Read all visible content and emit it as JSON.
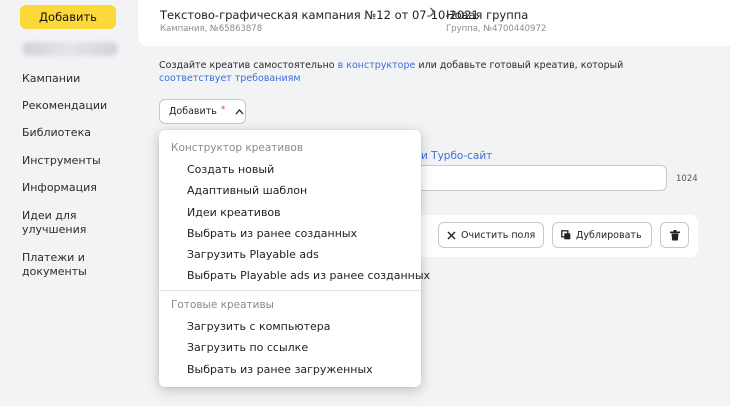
{
  "sidebar": {
    "add_label": "Добавить",
    "items": [
      {
        "label": "Кампании"
      },
      {
        "label": "Рекомендации"
      },
      {
        "label": "Библиотека"
      },
      {
        "label": "Инструменты"
      },
      {
        "label": "Информация"
      },
      {
        "label": "Идеи для улучшения"
      },
      {
        "label": "Платежи и документы"
      }
    ]
  },
  "breadcrumb": {
    "campaign_title": "Текстово-графическая кампания №12 от 07-10-2021",
    "campaign_sub": "Кампания, №65863878",
    "group_title": "Новая группа",
    "group_sub": "Группа, №4700440972"
  },
  "intro": {
    "part1": "Создайте креатив самостоятельно ",
    "link1": "в конструкторе",
    "part2": " или добавьте готовый креатив, который ",
    "link2": "соответствует требованиям"
  },
  "add_dropdown": {
    "label": "Добавить",
    "required_mark": "*"
  },
  "background": {
    "turbo_link": "и Турбо-сайт",
    "counter": "1024",
    "clear_label": "Очистить поля",
    "duplicate_label": "Дублировать"
  },
  "menu": {
    "group1_title": "Конструктор креативов",
    "group1_items": [
      "Создать новый",
      "Адаптивный шаблон",
      "Идеи креативов",
      "Выбрать из ранее созданных",
      "Загрузить Playable ads",
      "Выбрать Playable ads из ранее созданных"
    ],
    "group2_title": "Готовые креативы",
    "group2_items": [
      "Загрузить с компьютера",
      "Загрузить по ссылке",
      "Выбрать из ранее загруженных"
    ]
  },
  "colors": {
    "accent_yellow": "#fcd939",
    "link_blue": "#3e6fd9",
    "required_red": "#e0444f"
  }
}
